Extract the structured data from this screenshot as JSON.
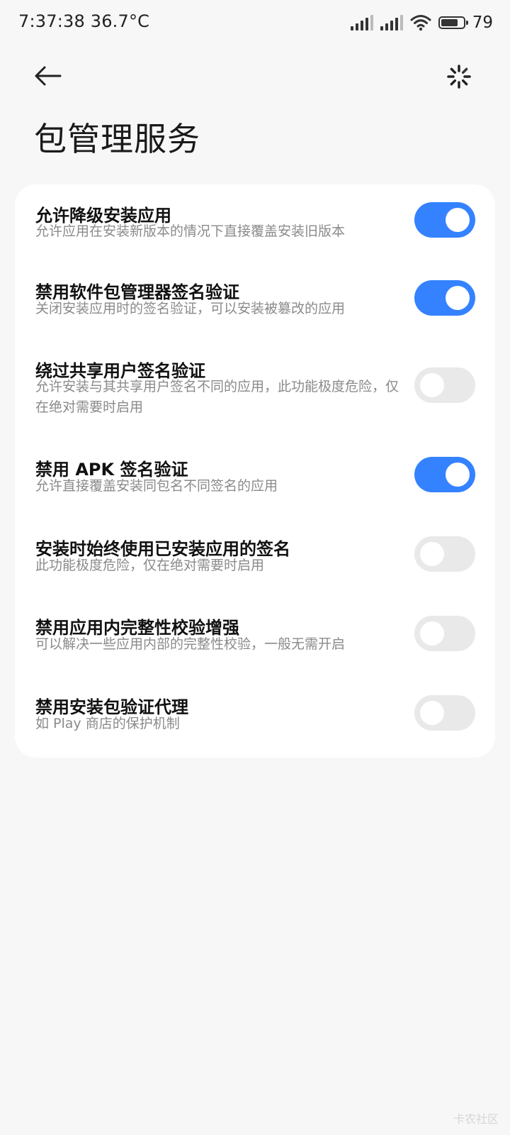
{
  "status_bar": {
    "time_temp": "7:37:38 36.7°C",
    "battery_level": "79"
  },
  "icons": {
    "back": "arrow-left-icon",
    "refresh": "loading-spinner-icon"
  },
  "page": {
    "title": "包管理服务"
  },
  "settings": [
    {
      "title": "允许降级安装应用",
      "description": "允许应用在安装新版本的情况下直接覆盖安装旧版本",
      "enabled": true
    },
    {
      "title": "禁用软件包管理器签名验证",
      "description": "关闭安装应用时的签名验证，可以安装被篡改的应用",
      "enabled": true
    },
    {
      "title": "绕过共享用户签名验证",
      "description": "允许安装与其共享用户签名不同的应用，此功能极度危险，仅在绝对需要时启用",
      "enabled": false
    },
    {
      "title": "禁用 APK 签名验证",
      "description": "允许直接覆盖安装同包名不同签名的应用",
      "enabled": true
    },
    {
      "title": "安装时始终使用已安装应用的签名",
      "description": "此功能极度危险，仅在绝对需要时启用",
      "enabled": false
    },
    {
      "title": "禁用应用内完整性校验增强",
      "description": "可以解决一些应用内部的完整性校验，一般无需开启",
      "enabled": false
    },
    {
      "title": "禁用安装包验证代理",
      "description": "如 Play 商店的保护机制",
      "enabled": false
    }
  ],
  "colors": {
    "toggle_on": "#3482ff",
    "toggle_off": "#e9e9e9",
    "background": "#f7f7f7",
    "card": "#ffffff"
  },
  "watermark": "卡农社区"
}
